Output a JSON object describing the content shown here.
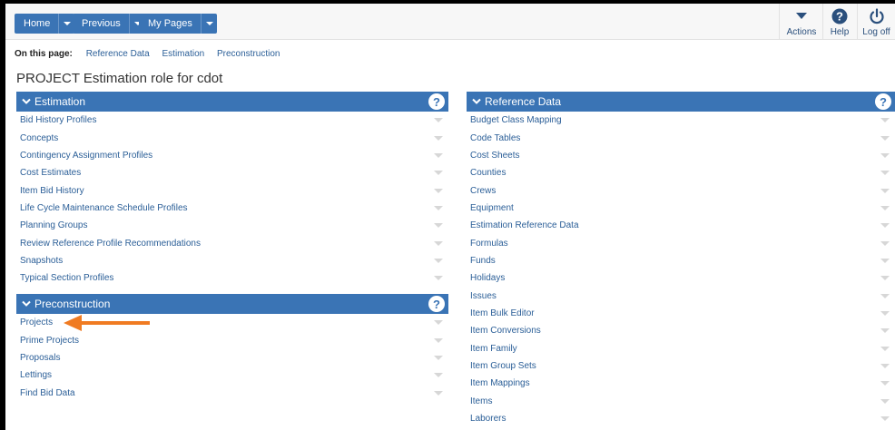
{
  "nav": {
    "home": "Home",
    "previous": "Previous",
    "my_pages": "My Pages"
  },
  "tools": {
    "actions": "Actions",
    "help": "Help",
    "logoff": "Log off"
  },
  "on_this_page": {
    "label": "On this page:",
    "links": [
      "Reference Data",
      "Estimation",
      "Preconstruction"
    ]
  },
  "page_title": "PROJECT Estimation role for cdot",
  "estimation": {
    "title": "Estimation",
    "items": [
      "Bid History Profiles",
      "Concepts",
      "Contingency Assignment Profiles",
      "Cost Estimates",
      "Item Bid History",
      "Life Cycle Maintenance Schedule Profiles",
      "Planning Groups",
      "Review Reference Profile Recommendations",
      "Snapshots",
      "Typical Section Profiles"
    ]
  },
  "preconstruction": {
    "title": "Preconstruction",
    "items": [
      "Projects",
      "Prime Projects",
      "Proposals",
      "Lettings",
      "Find Bid Data"
    ]
  },
  "reference_data": {
    "title": "Reference Data",
    "items": [
      "Budget Class Mapping",
      "Code Tables",
      "Cost Sheets",
      "Counties",
      "Crews",
      "Equipment",
      "Estimation Reference Data",
      "Formulas",
      "Funds",
      "Holidays",
      "Issues",
      "Item Bulk Editor",
      "Item Conversions",
      "Item Family",
      "Item Group Sets",
      "Item Mappings",
      "Items",
      "Laborers"
    ]
  },
  "colors": {
    "accent": "#3a74b5",
    "link": "#2a5e97",
    "arrow": "#f07b22"
  }
}
